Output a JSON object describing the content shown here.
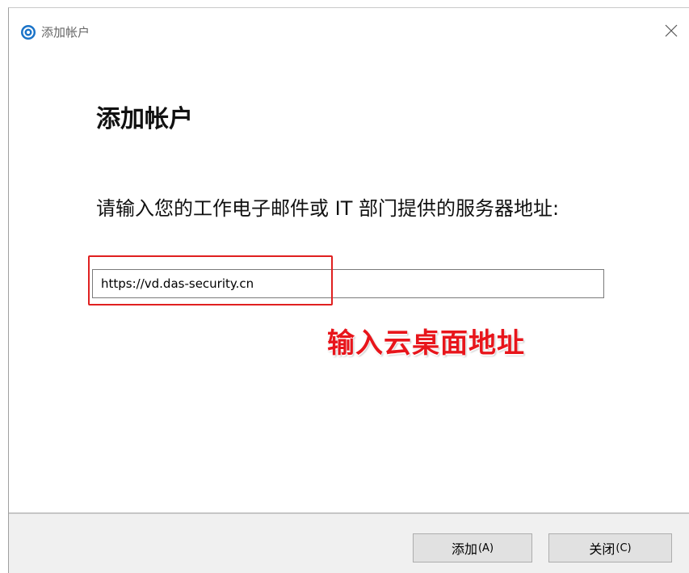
{
  "window": {
    "title": "添加帐户"
  },
  "main": {
    "heading": "添加帐户",
    "prompt": "请输入您的工作电子邮件或 IT 部门提供的服务器地址:",
    "url_value": "https://vd.das-security.cn",
    "annotation": "输入云桌面地址"
  },
  "footer": {
    "add_label": "添加",
    "add_key": "(A)",
    "close_label": "关闭",
    "close_key": "(C)"
  },
  "colors": {
    "highlight": "#e02020",
    "annotation": "#e8151b",
    "app_icon": "#1a73c8"
  },
  "icons": {
    "app": "app-logo-icon",
    "close": "close-icon"
  }
}
